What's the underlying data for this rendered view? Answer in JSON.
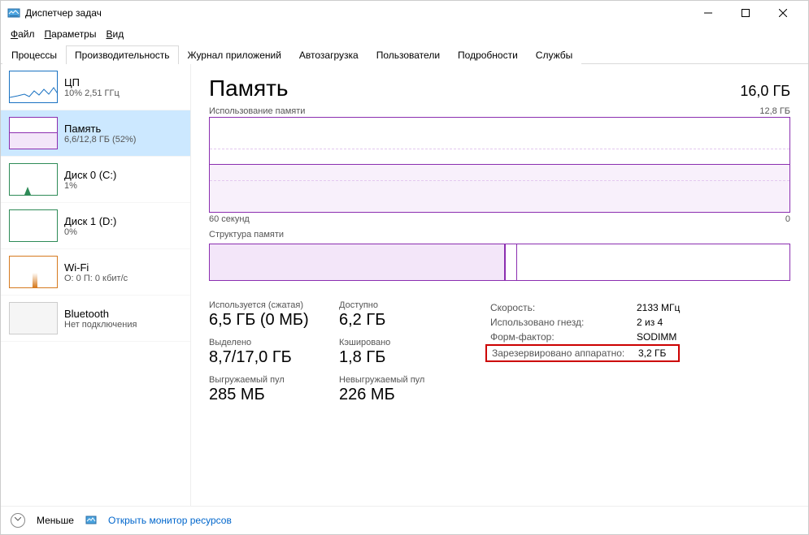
{
  "window": {
    "title": "Диспетчер задач"
  },
  "menu": {
    "file": "Файл",
    "options": "Параметры",
    "view": "Вид"
  },
  "tabs": [
    "Процессы",
    "Производительность",
    "Журнал приложений",
    "Автозагрузка",
    "Пользователи",
    "Подробности",
    "Службы"
  ],
  "active_tab": 1,
  "sidebar": [
    {
      "title": "ЦП",
      "sub": "10% 2,51 ГГц",
      "kind": "cpu"
    },
    {
      "title": "Память",
      "sub": "6,6/12,8 ГБ (52%)",
      "kind": "mem",
      "active": true
    },
    {
      "title": "Диск 0 (C:)",
      "sub": "1%",
      "kind": "disk0"
    },
    {
      "title": "Диск 1 (D:)",
      "sub": "0%",
      "kind": "disk1"
    },
    {
      "title": "Wi-Fi",
      "sub": "О: 0 П: 0 кбит/с",
      "kind": "wifi"
    },
    {
      "title": "Bluetooth",
      "sub": "Нет подключения",
      "kind": "bt"
    }
  ],
  "main": {
    "title": "Память",
    "total": "16,0 ГБ",
    "usage_label": "Использование памяти",
    "usage_max": "12,8 ГБ",
    "xaxis_left": "60 секунд",
    "xaxis_right": "0",
    "struct_label": "Структура памяти"
  },
  "metrics": {
    "used_label": "Используется (сжатая)",
    "used_value": "6,5 ГБ (0 МБ)",
    "avail_label": "Доступно",
    "avail_value": "6,2 ГБ",
    "commit_label": "Выделено",
    "commit_value": "8,7/17,0 ГБ",
    "cached_label": "Кэшировано",
    "cached_value": "1,8 ГБ",
    "paged_label": "Выгружаемый пул",
    "paged_value": "285 МБ",
    "nonpaged_label": "Невыгружаемый пул",
    "nonpaged_value": "226 МБ"
  },
  "details": {
    "speed_k": "Скорость:",
    "speed_v": "2133 МГц",
    "slots_k": "Использовано гнезд:",
    "slots_v": "2 из 4",
    "form_k": "Форм-фактор:",
    "form_v": "SODIMM",
    "reserved_k": "Зарезервировано аппаратно:",
    "reserved_v": "3,2 ГБ"
  },
  "footer": {
    "less": "Меньше",
    "monitor": "Открыть монитор ресурсов"
  }
}
